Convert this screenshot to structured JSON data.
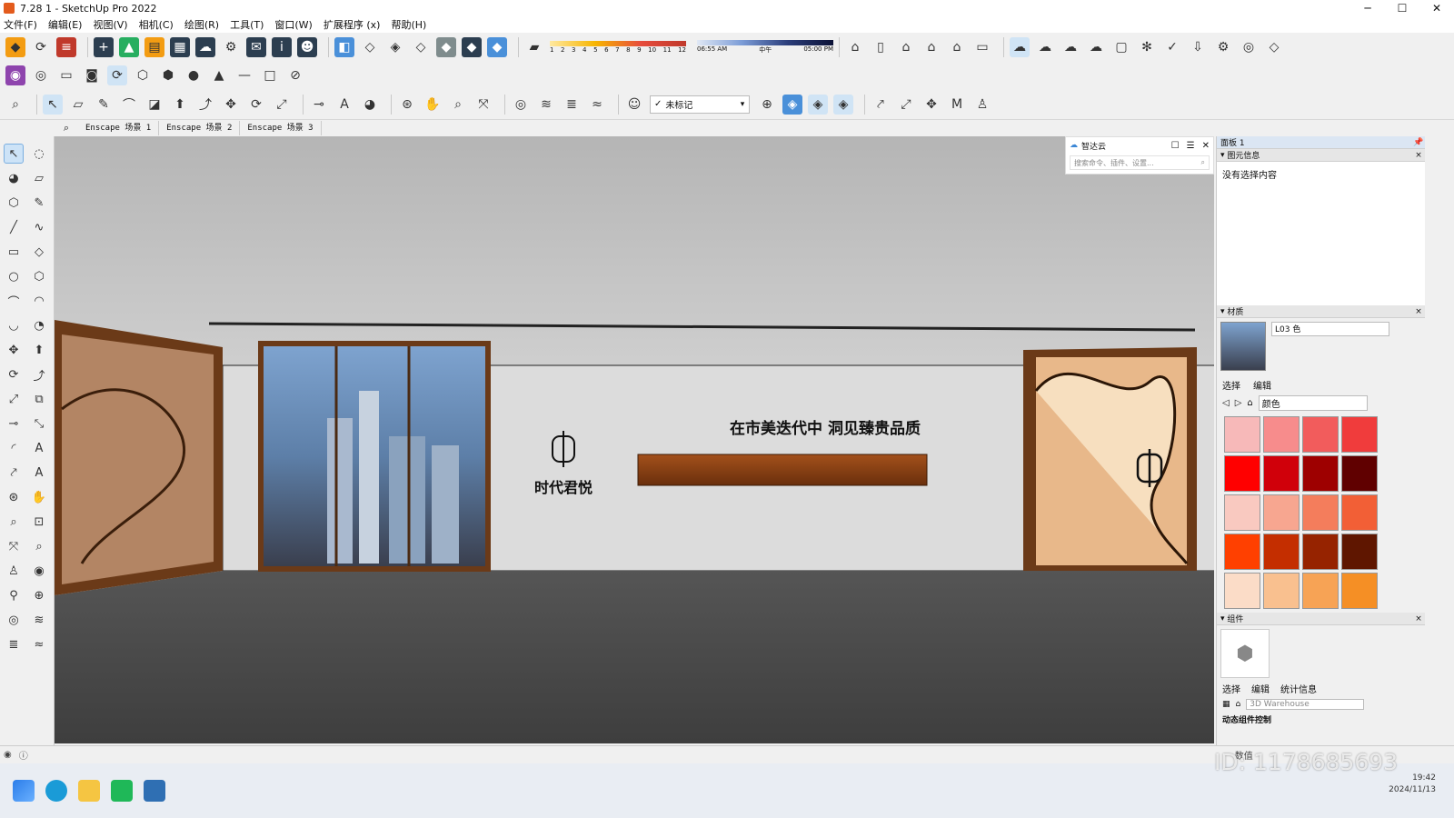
{
  "window": {
    "title": "7.28  1 - SketchUp Pro 2022",
    "minimize": "─",
    "maximize": "☐",
    "close": "✕"
  },
  "menu": [
    "文件(F)",
    "编辑(E)",
    "视图(V)",
    "相机(C)",
    "绘图(R)",
    "工具(T)",
    "窗口(W)",
    "扩展程序 (x)",
    "帮助(H)"
  ],
  "shadow": {
    "months": [
      "1",
      "2",
      "3",
      "4",
      "5",
      "6",
      "7",
      "8",
      "9",
      "10",
      "11",
      "12"
    ],
    "time_start": "06:55 AM",
    "time_mid": "中午",
    "time_end": "05:00 PM"
  },
  "tag_select": {
    "check": "✓",
    "value": "未标记"
  },
  "scenes": [
    "Enscape 场景 1",
    "Enscape 场景 2",
    "Enscape 场景 3"
  ],
  "zhidayun": {
    "title": "智达云",
    "search_placeholder": "搜索命令、插件、设置..."
  },
  "panel": {
    "title": "面板 1",
    "entity_info_title": "图元信息",
    "entity_info_empty": "没有选择内容",
    "materials_title": "材质",
    "material_name": "L03 色",
    "tab_select": "选择",
    "tab_edit": "编辑",
    "color_library": "颜色",
    "components_title": "组件",
    "comp_tab_select": "选择",
    "comp_tab_edit": "编辑",
    "comp_tab_stats": "统计信息",
    "comp_search": "3D Warehouse",
    "comp_dynamic": "动态组件控制",
    "extra": "数值"
  },
  "swatches": [
    "#f7b9b9",
    "#f78c8c",
    "#f25c5c",
    "#f03c3c",
    "#ff0000",
    "#d0000a",
    "#9e0000",
    "#600000",
    "#f9c9c0",
    "#f7a690",
    "#f47d5c",
    "#f25f36",
    "#ff4000",
    "#c42e00",
    "#962300",
    "#5f1600",
    "#fbdcc7",
    "#f9c08f",
    "#f7a355",
    "#f58f25"
  ],
  "scene_text": {
    "slogan": "在市美迭代中 洞见臻贵品质",
    "logo_name": "时代君悦"
  },
  "taskbar": {
    "time": "19:42",
    "date": "2024/11/13",
    "watermark": "ID: 1178685693"
  }
}
